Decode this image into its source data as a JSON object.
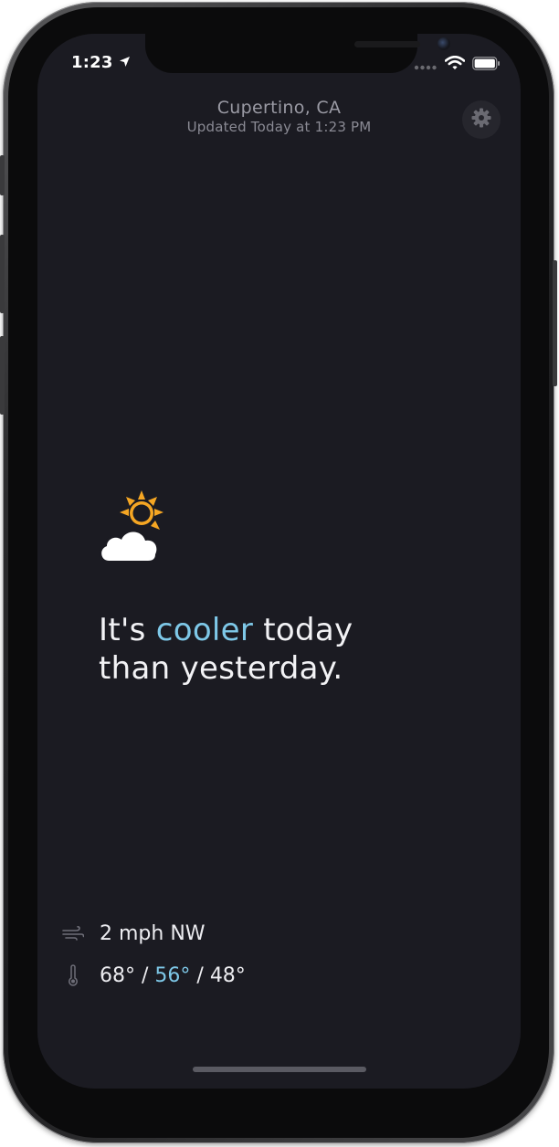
{
  "status_bar": {
    "time": "1:23",
    "location_icon": "location-arrow-icon",
    "signal_icon": "signal-dots-icon",
    "wifi_icon": "wifi-icon",
    "battery_icon": "battery-icon"
  },
  "header": {
    "city": "Cupertino, CA",
    "updated": "Updated Today at 1:23 PM"
  },
  "settings": {
    "icon": "gear-icon"
  },
  "forecast": {
    "icon": "partly-cloudy-icon",
    "headline_prefix": "It's ",
    "headline_accent": "cooler",
    "headline_suffix_line1": " today",
    "headline_line2": "than yesterday."
  },
  "details": {
    "wind": "2 mph NW",
    "temp_high": "68°",
    "temp_sep1": " / ",
    "temp_current": "56°",
    "temp_sep2": " / ",
    "temp_low": "48°"
  },
  "colors": {
    "background": "#1b1b22",
    "accent": "#7ec8e8",
    "sun": "#f5a623",
    "text": "#f2f2f5"
  }
}
